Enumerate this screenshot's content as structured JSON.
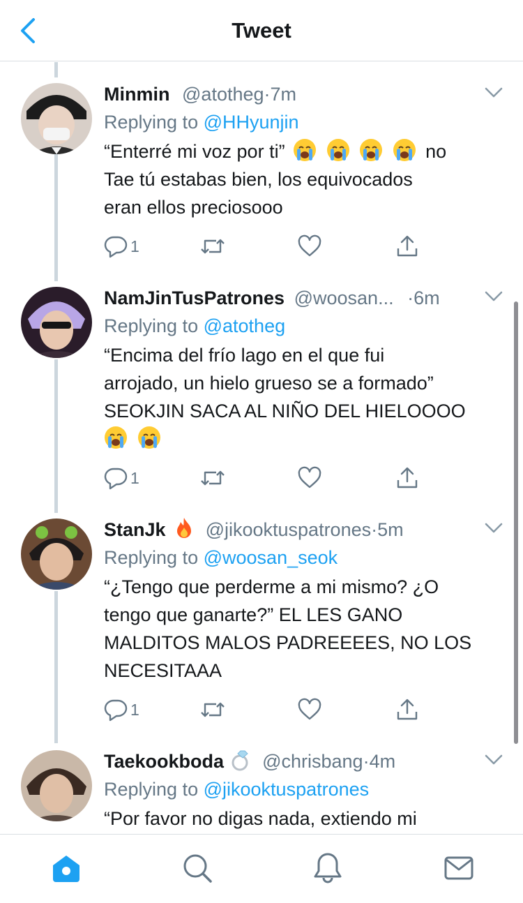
{
  "header": {
    "title": "Tweet"
  },
  "tweets": [
    {
      "name": "Minmin",
      "name_emoji": "",
      "handle": "@atotheg",
      "dot": "·",
      "time": "7m",
      "replying_prefix": "Replying to",
      "replying_to": "@HHyunjin",
      "text_lines": [
        "“Enterré mi voz por ti”",
        "Tae tú estabas bien, los equivocados",
        "eran ellos preciosooo"
      ],
      "text_line1_suffix": "no",
      "line1_emojis": 4,
      "reply_count": "1"
    },
    {
      "name": "NamJinTusPatrones",
      "handle": "@woosan...",
      "dot": "·",
      "time": "6m",
      "replying_prefix": "Replying to",
      "replying_to": "@atotheg",
      "text_lines": [
        "“Encima del frío lago en el que fui",
        "arrojado, un hielo grueso se a formado”",
        "SEOKJIN SACA AL NIÑO DEL HIELOOOO"
      ],
      "reply_count": "1"
    },
    {
      "name": "StanJk",
      "handle": "@jikooktuspatrones",
      "dot": "·",
      "time": "5m",
      "replying_prefix": "Replying to",
      "replying_to": "@woosan_seok",
      "text_lines": [
        "“¿Tengo que perderme a mi mismo? ¿O",
        "tengo que ganarte?” EL LES GANO",
        "MALDITOS MALOS PADREEEES, NO LOS",
        "NECESITAAA"
      ],
      "reply_count": "1"
    },
    {
      "name": "Taekookboda",
      "handle": "@chrisbang",
      "dot": "·",
      "time": "4m",
      "replying_prefix": "Replying to",
      "replying_to": "@jikooktuspatrones",
      "text_lines": [
        "“Por favor no digas nada, extiendo mi"
      ]
    }
  ],
  "icons": {
    "back": "chevron-left-icon",
    "reply": "speech-bubble-icon",
    "retweet": "retweet-icon",
    "like": "heart-icon",
    "share": "share-icon",
    "caret": "chevron-down-icon",
    "home": "home-icon",
    "search": "search-icon",
    "notifications": "bell-icon",
    "messages": "envelope-icon",
    "emoji_crying": "loudly-crying-face",
    "emoji_fire": "fire",
    "emoji_ring": "ring"
  },
  "colors": {
    "accent": "#1da1f2",
    "text": "#14171a",
    "secondary": "#657786",
    "divider": "#ccd6dd"
  }
}
